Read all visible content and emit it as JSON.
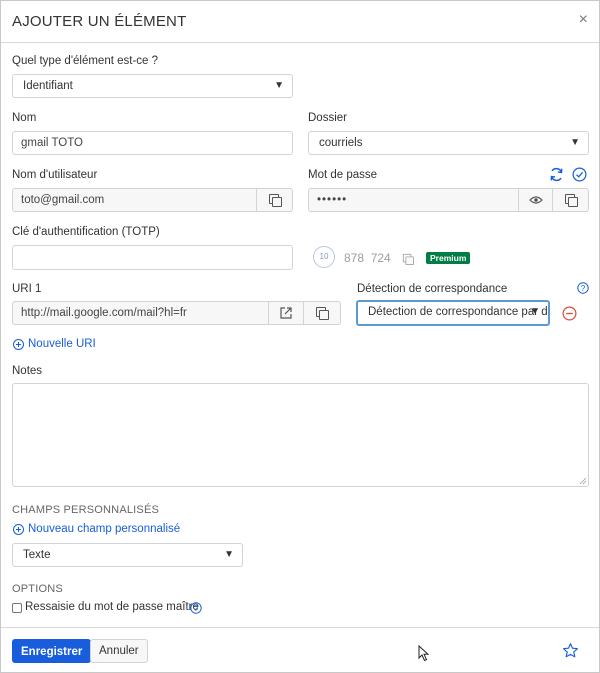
{
  "dialog": {
    "title": "AJOUTER UN ÉLÉMENT",
    "close": "×"
  },
  "item_type": {
    "label": "Quel type d'élément est-ce ?",
    "value": "Identifiant"
  },
  "name": {
    "label": "Nom",
    "value": "gmail TOTO"
  },
  "folder": {
    "label": "Dossier",
    "value": "courriels"
  },
  "username": {
    "label": "Nom d'utilisateur",
    "value": "toto@gmail.com"
  },
  "password": {
    "label": "Mot de passe",
    "value": "••••••"
  },
  "totp": {
    "label": "Clé d'authentification (TOTP)",
    "value": "",
    "countdown": "10",
    "code": "878  724",
    "badge": "Premium"
  },
  "uri": {
    "label": "URI 1",
    "value": "http://mail.google.com/mail?hl=fr",
    "match_label": "Détection de correspondance",
    "match_value": "Détection de correspondance par défaut",
    "new_uri": "Nouvelle URI"
  },
  "notes": {
    "label": "Notes",
    "value": ""
  },
  "custom_fields": {
    "heading": "CHAMPS PERSONNALISÉS",
    "new_field": "Nouveau champ personnalisé",
    "type_value": "Texte"
  },
  "options": {
    "heading": "OPTIONS",
    "reprompt_label": "Ressaisie du mot de passe maître"
  },
  "footer": {
    "save": "Enregistrer",
    "cancel": "Annuler"
  },
  "colors": {
    "primary": "#175ddc",
    "premium": "#017e45",
    "danger": "#dd4b39"
  }
}
